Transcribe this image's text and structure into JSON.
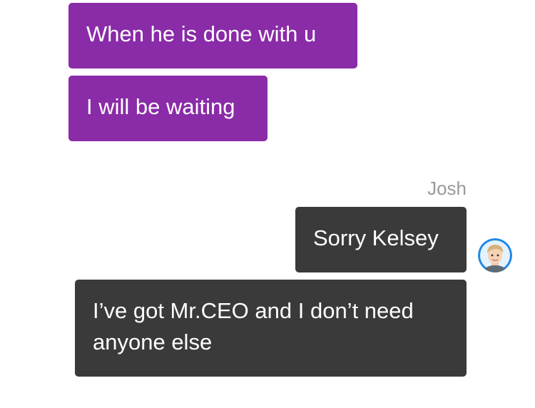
{
  "conversation": {
    "messages": [
      {
        "text": "When he is done with u",
        "style": "purple",
        "side": "left"
      },
      {
        "text": "I will be waiting",
        "style": "purple",
        "side": "left"
      },
      {
        "text": "Sorry Kelsey",
        "style": "dark",
        "side": "right",
        "sender": "Josh"
      },
      {
        "text": "I’ve got Mr.CEO and I don’t need anyone else",
        "style": "dark",
        "side": "right"
      }
    ],
    "sender_label": "Josh"
  },
  "colors": {
    "purple_bubble": "#8a2ba8",
    "dark_bubble": "#3a3a3a",
    "sender_label": "#9a9a9a",
    "avatar_ring": "#1e88e5"
  },
  "icons": {
    "avatar": "josh-avatar"
  }
}
